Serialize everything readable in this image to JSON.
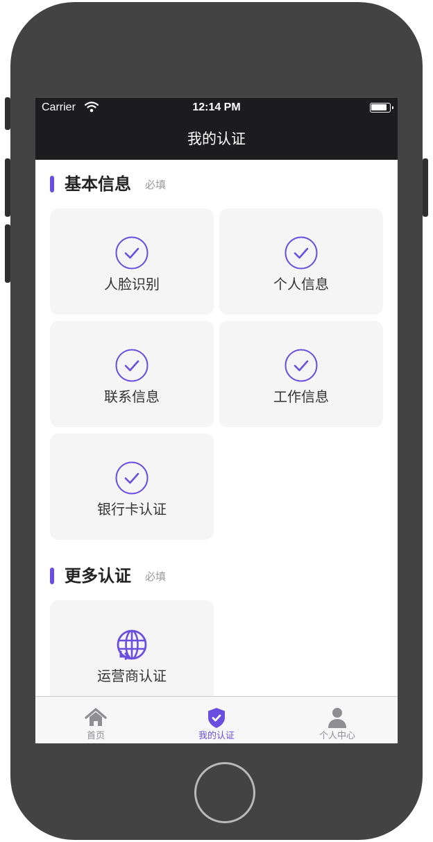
{
  "status_bar": {
    "carrier": "Carrier",
    "time": "12:14 PM"
  },
  "nav": {
    "title": "我的认证"
  },
  "sections": [
    {
      "title": "基本信息",
      "required": "必填",
      "items": [
        {
          "label": "人脸识别",
          "icon": "check-circle-icon"
        },
        {
          "label": "个人信息",
          "icon": "check-circle-icon"
        },
        {
          "label": "联系信息",
          "icon": "check-circle-icon"
        },
        {
          "label": "工作信息",
          "icon": "check-circle-icon"
        },
        {
          "label": "银行卡认证",
          "icon": "check-circle-icon"
        }
      ]
    },
    {
      "title": "更多认证",
      "required": "必填",
      "items": [
        {
          "label": "运营商认证",
          "icon": "globe-icon"
        }
      ]
    }
  ],
  "tabbar": {
    "items": [
      {
        "label": "首页",
        "icon": "home-icon",
        "active": false
      },
      {
        "label": "我的认证",
        "icon": "shield-check-icon",
        "active": true
      },
      {
        "label": "个人中心",
        "icon": "person-icon",
        "active": false
      }
    ]
  },
  "colors": {
    "accent": "#6a4ee0",
    "inactive": "#8e8e93",
    "nav_bg": "#1c1c1e",
    "card_bg": "#f5f5f5"
  }
}
